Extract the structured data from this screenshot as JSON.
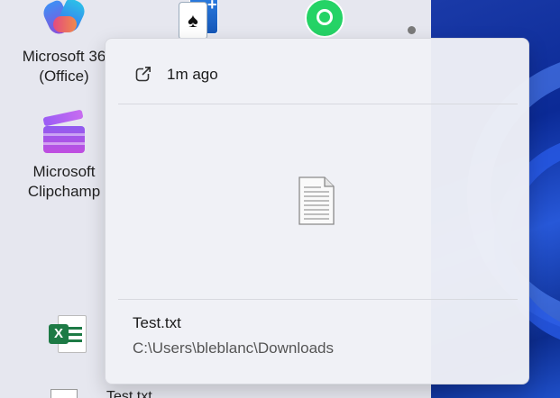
{
  "desktop": {
    "icons": [
      {
        "label_line1": "Microsoft 36",
        "label_line2": "(Office)"
      },
      {
        "label_line1": "Microsoft",
        "label_line2": "Clipchamp"
      }
    ],
    "bottom_label": "Test.txt"
  },
  "flyout": {
    "time_ago": "1m ago",
    "file_name": "Test.txt",
    "file_path": "C:\\Users\\bleblanc\\Downloads"
  },
  "colors": {
    "flyout_bg": "#f0f1f6",
    "wallpaper_accent": "#1a3aa8",
    "excel_green": "#1d7a45",
    "whatsapp_green": "#25d366"
  },
  "icons": {
    "open": "open-external-icon",
    "file": "text-file-icon"
  }
}
